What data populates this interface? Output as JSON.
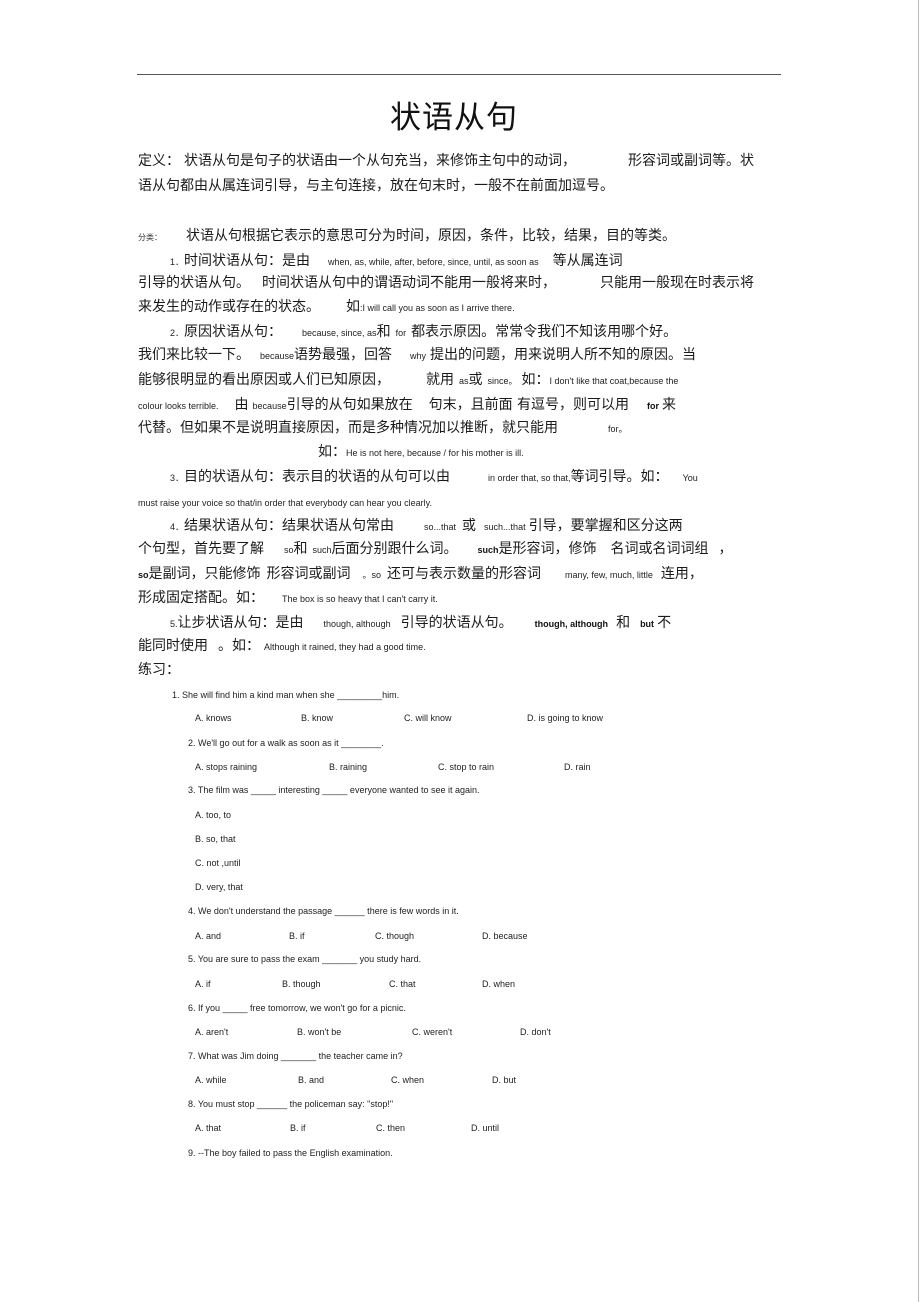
{
  "doc": {
    "title": "状语从句",
    "definition": {
      "label": "定义：",
      "line1_a": "状语从句是句子的状语由一个从句充当，来修饰主句中的动词，",
      "line1_b": "形容词或副词等。状",
      "line2": "语从句都由从属连词引导，与主句连接，放在句末时，一般不在前面加逗号。"
    },
    "classification": {
      "label": "分类：",
      "text": "状语从句根据它表示的意思可分为时间，原因，条件，比较，结果，目的等类。"
    },
    "section1": {
      "num": "1．",
      "head": "时间状语从句：是由",
      "conj": "when, as, while, after, before, since, until, as soon as",
      "tail": "等从属连词",
      "line2_a": "引导的状语从句。",
      "line2_b": "时间状语从句中的谓语动词不能用一般将来时，",
      "line2_c": "只能用一般现在时表示将",
      "line3_a": "来发生的动作或存在的状态。",
      "line3_b": "如",
      "example": ":I will call you as soon as I arrive there."
    },
    "section2": {
      "num": "2．",
      "head": "原因状语从句：",
      "conj": "because, since, as",
      "and": "和",
      "for": "for",
      "tail": "都表示原因。常常令我们不知该用哪个好。",
      "l2_a": "我们来比较一下。",
      "l2_because": "because",
      "l2_b": "语势最强，回答",
      "l2_why": "why",
      "l2_c": "提出的问题，用来说明人所不知的原因。当",
      "l3_a": "能够很明显的看出原因或人们已知原因，",
      "l3_b": "就用",
      "l3_as": "as",
      "l3_or": "或",
      "l3_since": "since。",
      "l3_ru": "如：",
      "l3_ex": "I don't like that coat,because the",
      "l4_ex": "colour looks terrible.",
      "l4_a": "由",
      "l4_because": "because",
      "l4_b": "引导的从句如果放在",
      "l4_c": "句末，且前面 有逗号，则可以用",
      "l4_for": "for",
      "l4_d": "来",
      "l5_a": "代替。但如果不是说明直接原因，而是多种情况加以推断，就只能用",
      "l5_for": "for。",
      "l6_ru": "如：",
      "l6_ex": "He is not here, because / for his mother is ill."
    },
    "section3": {
      "num": "3．",
      "head": "目的状语从句：表示目的状语的从句可以由",
      "conj": "in order that, so that,",
      "tail": "等词引导。如：",
      "ex_start": "You",
      "ex_line2": "must raise your voice so that/in order that everybody can hear you clearly."
    },
    "section4": {
      "num": "4．",
      "head": "结果状语从句：结果状语从句常由",
      "conj1": "so...that",
      "or": "或",
      "conj2": "such...that",
      "tail": "引导，要掌握和区分这两",
      "l2_a": "个句型，首先要了解",
      "l2_so": "so",
      "l2_and": "和",
      "l2_such": "such",
      "l2_b": "后面分别跟什么词。",
      "l2_such_b": "such",
      "l2_c": "是形容词，修饰",
      "l2_d": "名词或名词词组",
      "l2_comma": "，",
      "l3_so": "so",
      "l3_a": "是副词，只能修饰",
      "l3_b": "形容词或副词",
      "l3_c": "。so",
      "l3_d": "还可与表示数量的形容词",
      "l3_words": "many, few, much, little",
      "l3_e": "连用，",
      "l4_a": "形成固定搭配。如：",
      "l4_ex": "The box is so heavy that I can't carry it."
    },
    "section5": {
      "num": "5.",
      "head": "让步状语从句：是由",
      "conj": "though,  although",
      "mid": "引导的状语从句。",
      "bold": "though, although",
      "and": "和",
      "but": "but",
      "tail": "不",
      "l2_a": "能同时使用",
      "l2_b": "。如：",
      "l2_ex": "Although it rained, they had a good time."
    },
    "practice_label": "练习：",
    "questions": [
      {
        "text": "1. She will find him a kind man when she _________him.",
        "options": [
          "A. knows",
          "B. know",
          "C. will know",
          "D. is going to know"
        ]
      },
      {
        "text": "2. We'll go out for a walk as soon as it ________.",
        "options": [
          "A. stops raining",
          "B. raining",
          "C. stop to rain",
          "D. rain"
        ]
      },
      {
        "text": "3. The film was _____ interesting _____ everyone wanted to see it again.",
        "options": [
          "A. too, to",
          "B. so, that",
          "C. not ,until",
          "D. very, that"
        ]
      },
      {
        "text": "4. We don't understand the passage ______ there is few words in it.",
        "options": [
          "A. and",
          "B. if",
          "C. though",
          "D. because"
        ]
      },
      {
        "text": "5. You are sure to pass the exam _______ you study hard.",
        "options": [
          "A. if",
          "B. though",
          "C. that",
          "D. when"
        ]
      },
      {
        "text": "6. If you _____ free tomorrow, we won't go for a picnic.",
        "options": [
          "A. aren't",
          "B. won't be",
          "C. weren't",
          "D. don't"
        ]
      },
      {
        "text": "7. What was Jim doing _______ the teacher came in?",
        "options": [
          "A. while",
          "B. and",
          "C. when",
          "D. but"
        ]
      },
      {
        "text": "8. You must stop ______ the policeman say: \"stop!\"",
        "options": [
          "A. that",
          "B. if",
          "C. then",
          "D. until"
        ]
      },
      {
        "text": "9. --The boy failed to pass the English examination.",
        "options": []
      }
    ]
  }
}
